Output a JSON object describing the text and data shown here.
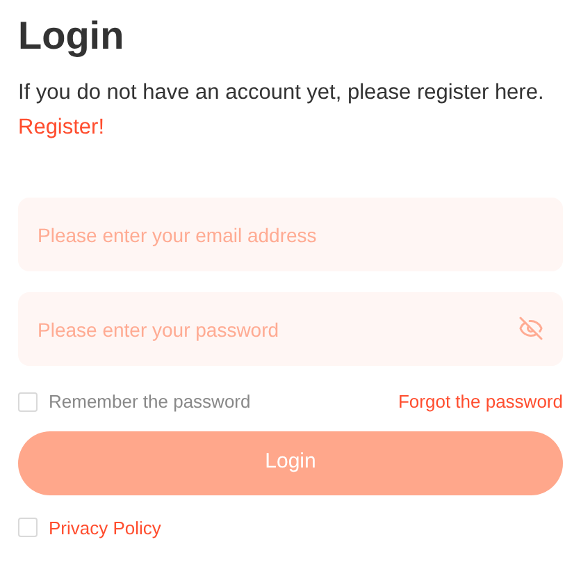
{
  "title": "Login",
  "intro": "If you do not have an account yet, please register here.",
  "register_link": "Register!",
  "email_field": {
    "placeholder": "Please enter your email address"
  },
  "password_field": {
    "placeholder": "Please enter your password",
    "visible": false
  },
  "remember": {
    "label": "Remember the password",
    "checked": false
  },
  "forgot_link": "Forgot the password",
  "login_button": "Login",
  "privacy": {
    "label": "Privacy Policy",
    "checked": false
  }
}
